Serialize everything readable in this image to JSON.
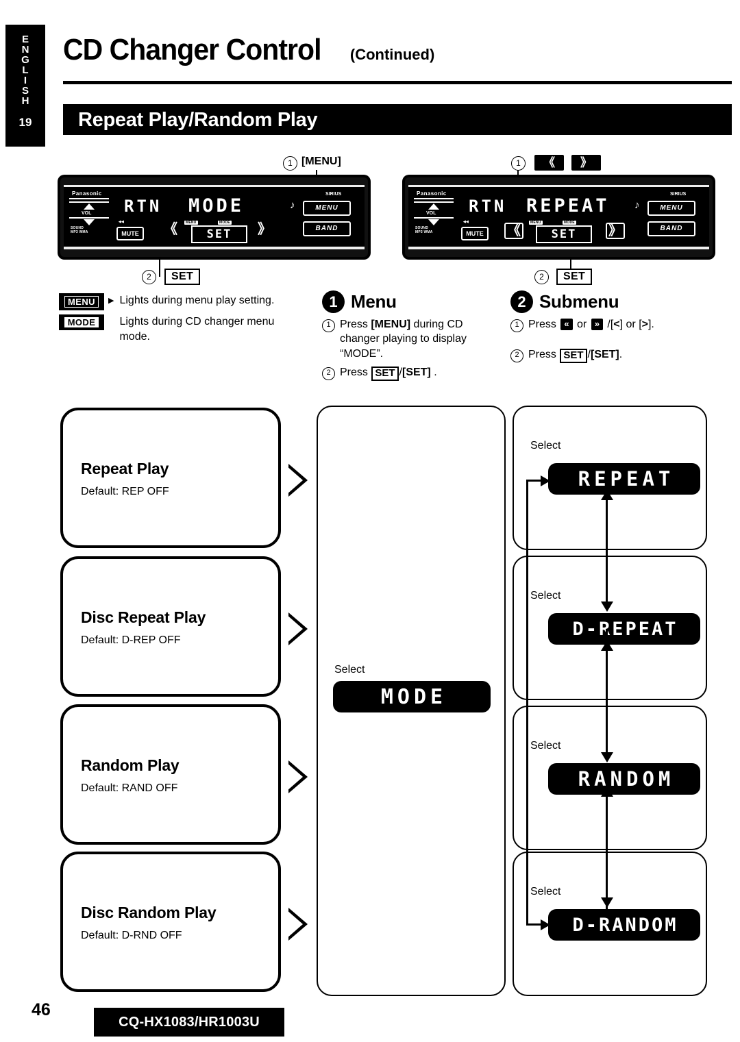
{
  "side_tab": {
    "letters": [
      "E",
      "N",
      "G",
      "L",
      "I",
      "S",
      "H"
    ],
    "page_number": "19"
  },
  "header": {
    "title": "CD Changer Control",
    "title_suffix": "(Continued)",
    "section": "Repeat Play/Random Play"
  },
  "device_left": {
    "brand": "Panasonic",
    "volume_label": "VOL",
    "volume_sub": "SOUND\nMP3 WMA",
    "display_left": "RTN",
    "display_main": "MODE",
    "mute_label": "MUTE",
    "set_label": "SET",
    "tag_menu": "MENU",
    "tag_mode": "MODE",
    "key_menu": "MENU",
    "key_band": "BAND",
    "sirius_label": "SIRIUS",
    "callout_1_num": "1",
    "callout_1_label": "[MENU]",
    "callout_2_num": "2",
    "callout_2_label": "SET"
  },
  "device_right": {
    "brand": "Panasonic",
    "volume_label": "VOL",
    "display_left": "RTN",
    "display_main": "REPEAT",
    "mute_label": "MUTE",
    "set_label": "SET",
    "tag_menu": "MENU",
    "tag_mode": "MODE",
    "key_menu": "MENU",
    "key_band": "BAND",
    "sirius_label": "SIRIUS",
    "callout_1_num": "1",
    "callout_2_num": "2",
    "callout_2_label": "SET",
    "btn_prev_icon": "double-chevron-left-icon",
    "btn_next_icon": "double-chevron-right-icon"
  },
  "legend": [
    {
      "tag": "MENU",
      "style": "outline-on-black",
      "text": "Lights during menu play setting."
    },
    {
      "tag": "MODE",
      "style": "white-on-black",
      "text": "Lights during CD changer menu mode."
    }
  ],
  "steps": [
    {
      "number": "1",
      "title": "Menu",
      "items": [
        {
          "num": "1",
          "parts": [
            "Press ",
            "[MENU]",
            " during CD changer playing to display “MODE”."
          ]
        },
        {
          "num": "2",
          "parts": [
            "Press ",
            "SET",
            "/",
            "[SET]",
            " ."
          ]
        }
      ]
    },
    {
      "number": "2",
      "title": "Submenu",
      "items": [
        {
          "num": "1",
          "parts": [
            "Press ",
            "«",
            " or ",
            "»",
            " /[",
            "<",
            "] or [",
            ">",
            "]."
          ]
        },
        {
          "num": "2",
          "parts": [
            "Press ",
            "SET",
            "/",
            "[SET]",
            "."
          ]
        }
      ]
    }
  ],
  "flow": {
    "left_boxes": [
      {
        "title": "Repeat Play",
        "sub": "Default: REP OFF"
      },
      {
        "title": "Disc Repeat Play",
        "sub": "Default: D-REP OFF"
      },
      {
        "title": "Random Play",
        "sub": "Default: RAND OFF"
      },
      {
        "title": "Disc Random Play",
        "sub": "Default: D-RND OFF"
      }
    ],
    "middle": {
      "select_label": "Select",
      "display": "MODE"
    },
    "right_boxes": [
      {
        "select_label": "Select",
        "display": "REPEAT"
      },
      {
        "select_label": "Select",
        "display": "D-REPEAT"
      },
      {
        "select_label": "Select",
        "display": "RANDOM"
      },
      {
        "select_label": "Select",
        "display": "D-RANDOM"
      }
    ]
  },
  "footer": {
    "page": "46",
    "model": "CQ-HX1083/HR1003U"
  }
}
